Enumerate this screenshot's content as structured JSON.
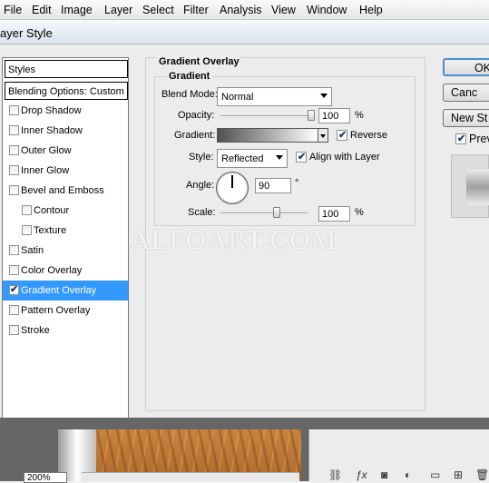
{
  "menubar": {
    "items": [
      "File",
      "Edit",
      "Image",
      "Layer",
      "Select",
      "Filter",
      "Analysis",
      "View",
      "Window",
      "Help"
    ]
  },
  "window": {
    "title": "ayer Style"
  },
  "styles_panel": {
    "header": "Styles",
    "blending_options": "Blending Options: Custom",
    "items": [
      {
        "label": "Drop Shadow",
        "checked": false
      },
      {
        "label": "Inner Shadow",
        "checked": false
      },
      {
        "label": "Outer Glow",
        "checked": false
      },
      {
        "label": "Inner Glow",
        "checked": false
      },
      {
        "label": "Bevel and Emboss",
        "checked": false
      },
      {
        "label": "Contour",
        "checked": false
      },
      {
        "label": "Texture",
        "checked": false
      },
      {
        "label": "Satin",
        "checked": false
      },
      {
        "label": "Color Overlay",
        "checked": false
      },
      {
        "label": "Gradient Overlay",
        "checked": true,
        "selected": true
      },
      {
        "label": "Pattern Overlay",
        "checked": false
      },
      {
        "label": "Stroke",
        "checked": false
      }
    ]
  },
  "gradient_overlay": {
    "group_title": "Gradient Overlay",
    "subgroup_title": "Gradient",
    "blend_mode_label": "Blend Mode:",
    "blend_mode_value": "Normal",
    "opacity_label": "Opacity:",
    "opacity_value": "100",
    "opacity_unit": "%",
    "gradient_label": "Gradient:",
    "gradient_colors": [
      "#505050",
      "#ffffff"
    ],
    "reverse_label": "Reverse",
    "reverse_checked": true,
    "style_label": "Style:",
    "style_value": "Reflected",
    "align_label": "Align with Layer",
    "align_checked": true,
    "angle_label": "Angle:",
    "angle_value": "90",
    "angle_unit": "°",
    "scale_label": "Scale:",
    "scale_value": "100",
    "scale_unit": "%"
  },
  "buttons": {
    "ok": "OK",
    "cancel": "Canc",
    "new_style": "New St",
    "preview_label": "Prev",
    "preview_checked": true
  },
  "watermark": "ALFOART.COM",
  "status": {
    "zoom": "200%"
  },
  "colors": {
    "selection": "#3399ff",
    "ok_border": "#4a8ed0"
  }
}
